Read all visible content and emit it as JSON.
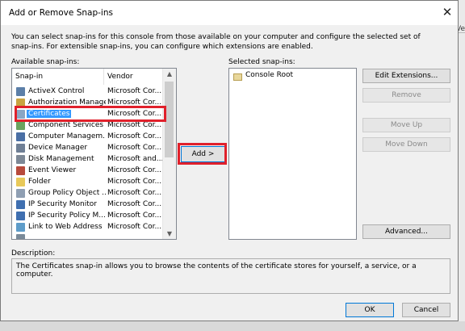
{
  "dialog": {
    "title": "Add or Remove Snap-ins",
    "intro": "You can select snap-ins for this console from those available on your computer and configure the selected set of snap-ins. For extensible snap-ins, you can configure which extensions are enabled."
  },
  "available": {
    "label": "Available snap-ins:",
    "col_snapin": "Snap-in",
    "col_vendor": "Vendor",
    "items": [
      {
        "name": "ActiveX Control",
        "vendor": "Microsoft Cor..."
      },
      {
        "name": "Authorization Manager",
        "vendor": "Microsoft Cor..."
      },
      {
        "name": "Certificates",
        "vendor": "Microsoft Cor..."
      },
      {
        "name": "Component Services",
        "vendor": "Microsoft Cor..."
      },
      {
        "name": "Computer Managem...",
        "vendor": "Microsoft Cor..."
      },
      {
        "name": "Device Manager",
        "vendor": "Microsoft Cor..."
      },
      {
        "name": "Disk Management",
        "vendor": "Microsoft and..."
      },
      {
        "name": "Event Viewer",
        "vendor": "Microsoft Cor..."
      },
      {
        "name": "Folder",
        "vendor": "Microsoft Cor..."
      },
      {
        "name": "Group Policy Object ...",
        "vendor": "Microsoft Cor..."
      },
      {
        "name": "IP Security Monitor",
        "vendor": "Microsoft Cor..."
      },
      {
        "name": "IP Security Policy M...",
        "vendor": "Microsoft Cor..."
      },
      {
        "name": "Link to Web Address",
        "vendor": "Microsoft Cor..."
      }
    ]
  },
  "add_button": "Add >",
  "selected": {
    "label": "Selected snap-ins:",
    "items": [
      {
        "name": "Console Root"
      }
    ]
  },
  "buttons": {
    "edit_extensions": "Edit Extensions...",
    "remove": "Remove",
    "move_up": "Move Up",
    "move_down": "Move Down",
    "advanced": "Advanced...",
    "ok": "OK",
    "cancel": "Cancel"
  },
  "description": {
    "label": "Description:",
    "text": "The Certificates snap-in allows you to browse the contents of the certificate stores for yourself, a service, or a computer."
  },
  "background_fragment": "Ve",
  "colors": {
    "highlight": "#e0202b",
    "selection": "#3399ff"
  }
}
